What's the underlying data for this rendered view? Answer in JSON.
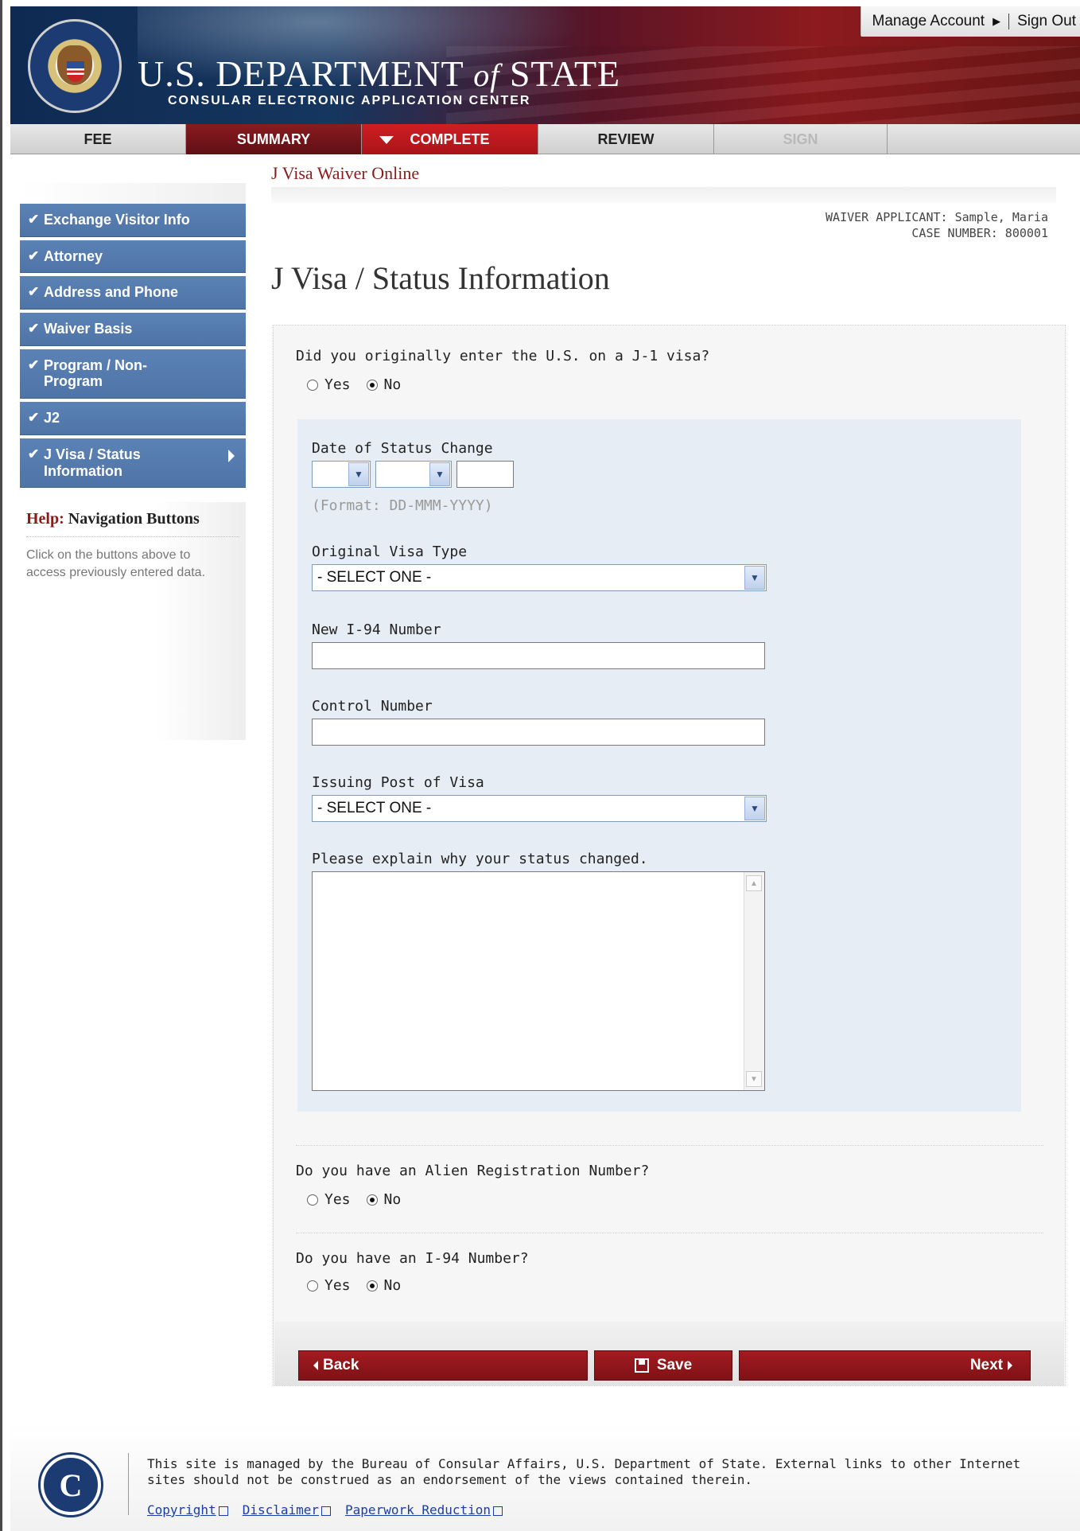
{
  "header": {
    "manage_account": "Manage Account",
    "sign_out": "Sign Out",
    "title_main": "U.S. DEPARTMENT",
    "title_of": "of",
    "title_state": "STATE",
    "subtitle": "CONSULAR ELECTRONIC APPLICATION CENTER"
  },
  "tabs": [
    {
      "label": "FEE"
    },
    {
      "label": "SUMMARY"
    },
    {
      "label": "COMPLETE"
    },
    {
      "label": "REVIEW"
    },
    {
      "label": "SIGN"
    }
  ],
  "breadcrumb": "J Visa Waiver Online",
  "applicant": {
    "line1": "WAIVER APPLICANT: Sample, Maria",
    "line2": "CASE NUMBER: 800001"
  },
  "page_title": "J Visa / Status Information",
  "sidebar": {
    "items": [
      {
        "label": "Exchange Visitor Info"
      },
      {
        "label": "Attorney"
      },
      {
        "label": "Address and Phone"
      },
      {
        "label": "Waiver Basis"
      },
      {
        "label": "Program / Non-Program"
      },
      {
        "label": "J2"
      },
      {
        "label": "J Visa / Status Information"
      }
    ],
    "help_prefix": "Help:",
    "help_title": "Navigation Buttons",
    "help_text": "Click on the buttons above to access previously entered data."
  },
  "form": {
    "q1": "Did you originally enter the U.S. on a J-1 visa?",
    "yes": "Yes",
    "no": "No",
    "date_label": "Date of Status Change",
    "date_format": "(Format: DD-MMM-YYYY)",
    "visa_type_label": "Original Visa Type",
    "visa_type_value": "- SELECT ONE -",
    "i94_new_label": "New I-94 Number",
    "control_label": "Control Number",
    "post_label": "Issuing Post of Visa",
    "post_value": "- SELECT ONE -",
    "explain_label": "Please explain why your status changed.",
    "q2": "Do you have an Alien Registration Number?",
    "q3": "Do you have an I-94 Number?"
  },
  "buttons": {
    "back": "Back",
    "save": "Save",
    "next": "Next"
  },
  "footer": {
    "text": "This site is managed by the Bureau of Consular Affairs, U.S. Department of State. External links to other Internet sites should not be construed as an endorsement of the views contained therein.",
    "links": [
      "Copyright",
      "Disclaimer",
      "Paperwork Reduction"
    ]
  },
  "colors": {
    "brand_red": "#8b1a1a",
    "sidebar_blue": "#4f74a6",
    "panel_blue": "#e6edf5"
  }
}
